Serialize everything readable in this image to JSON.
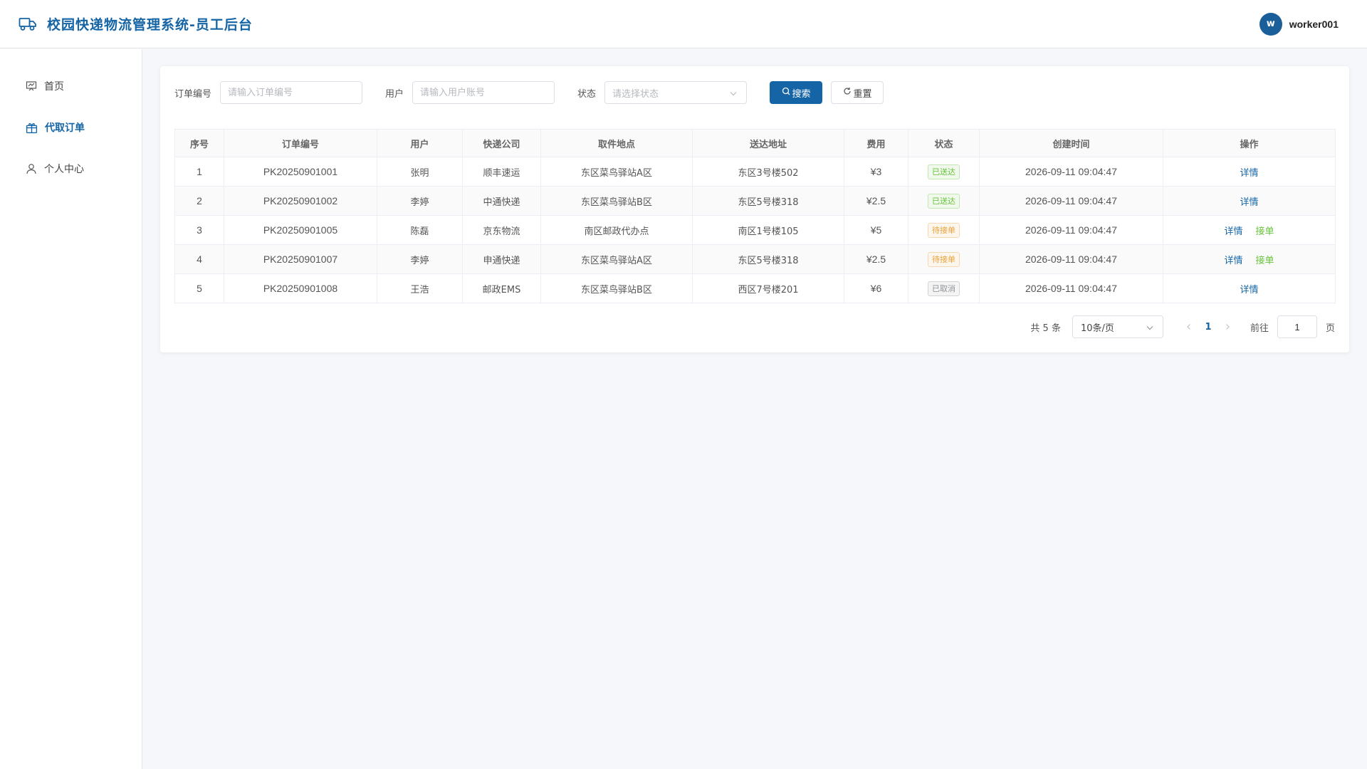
{
  "app": {
    "title": "校园快递物流管理系统-员工后台",
    "brand_color": "#1565a6"
  },
  "user": {
    "avatar_letter": "w",
    "name": "worker001"
  },
  "sidebar": {
    "items": [
      {
        "label": "首页",
        "icon": "home-icon",
        "active": false
      },
      {
        "label": "代取订单",
        "icon": "package-icon",
        "active": true
      },
      {
        "label": "个人中心",
        "icon": "user-icon",
        "active": false
      }
    ]
  },
  "filters": {
    "order_no_label": "订单编号",
    "order_no_placeholder": "请输入订单编号",
    "order_no_value": "",
    "user_label": "用户",
    "user_placeholder": "请输入用户账号",
    "user_value": "",
    "status_label": "状态",
    "status_placeholder": "请选择状态",
    "search_label": "搜索",
    "reset_label": "重置"
  },
  "table": {
    "columns": [
      "序号",
      "订单编号",
      "用户",
      "快递公司",
      "取件地点",
      "送达地址",
      "费用",
      "状态",
      "创建时间",
      "操作"
    ],
    "rows": [
      {
        "index": "1",
        "order_no": "PK20250901001",
        "user": "张明",
        "company": "顺丰速运",
        "pickup": "东区菜鸟驿站A区",
        "address": "东区3号楼502",
        "fee": "¥3",
        "status": "已送达",
        "status_type": "success",
        "created": "2026-09-11 09:04:47",
        "actions": [
          "详情"
        ]
      },
      {
        "index": "2",
        "order_no": "PK20250901002",
        "user": "李婷",
        "company": "中通快递",
        "pickup": "东区菜鸟驿站B区",
        "address": "东区5号楼318",
        "fee": "¥2.5",
        "status": "已送达",
        "status_type": "success",
        "created": "2026-09-11 09:04:47",
        "actions": [
          "详情"
        ]
      },
      {
        "index": "3",
        "order_no": "PK20250901005",
        "user": "陈磊",
        "company": "京东物流",
        "pickup": "南区邮政代办点",
        "address": "南区1号楼105",
        "fee": "¥5",
        "status": "待接单",
        "status_type": "warning",
        "created": "2026-09-11 09:04:47",
        "actions": [
          "详情",
          "接单"
        ]
      },
      {
        "index": "4",
        "order_no": "PK20250901007",
        "user": "李婷",
        "company": "申通快递",
        "pickup": "东区菜鸟驿站A区",
        "address": "东区5号楼318",
        "fee": "¥2.5",
        "status": "待接单",
        "status_type": "warning",
        "created": "2026-09-11 09:04:47",
        "actions": [
          "详情",
          "接单"
        ]
      },
      {
        "index": "5",
        "order_no": "PK20250901008",
        "user": "王浩",
        "company": "邮政EMS",
        "pickup": "东区菜鸟驿站B区",
        "address": "西区7号楼201",
        "fee": "¥6",
        "status": "已取消",
        "status_type": "info",
        "created": "2026-09-11 09:04:47",
        "actions": [
          "详情"
        ]
      }
    ]
  },
  "pagination": {
    "total_text": "共 5 条",
    "page_size": "10条/页",
    "current_page": "1",
    "goto_label": "前往",
    "goto_value": "1",
    "page_suffix": "页"
  }
}
